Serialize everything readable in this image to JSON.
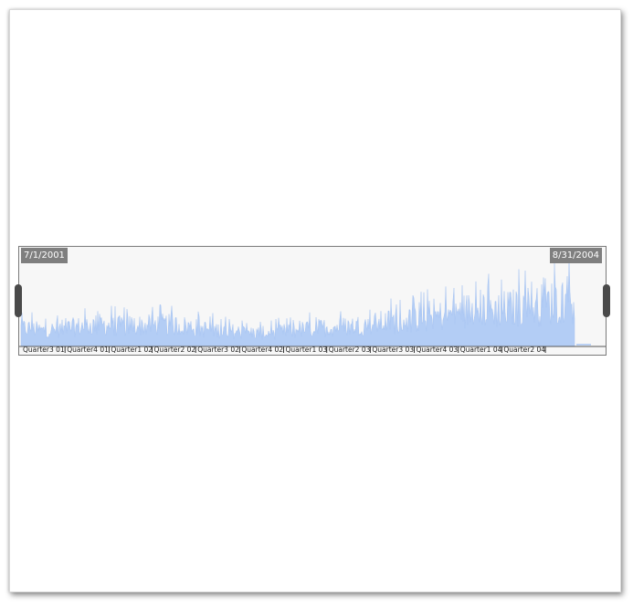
{
  "navigator": {
    "start_label": "7/1/2001",
    "end_label": "8/31/2004"
  },
  "colors": {
    "fill": "#b3cdf5",
    "stroke": "#a7c4f2",
    "background": "#f7f7f7",
    "label_bg": "#7f7f7f",
    "handle": "#4a4a4a"
  },
  "chart_data": {
    "type": "area",
    "xlabel": "",
    "ylabel": "",
    "tick_labels": [
      "Quarter3 01",
      "Quarter4 01",
      "Quarter1 02",
      "Quarter2 02",
      "Quarter3 02",
      "Quarter4 02",
      "Quarter1 03",
      "Quarter2 03",
      "Quarter3 03",
      "Quarter4 03",
      "Quarter1 04",
      "Quarter2 04"
    ],
    "x_range": [
      "2001-07-01",
      "2004-08-31"
    ],
    "ylim": [
      0,
      100
    ],
    "grid": false,
    "legend": "none",
    "series": [
      {
        "x": [
          "2001-07",
          "2001-08",
          "2001-09",
          "2001-10",
          "2001-11",
          "2001-12",
          "2002-01",
          "2002-02",
          "2002-03",
          "2002-04",
          "2002-05",
          "2002-06",
          "2002-07",
          "2002-08",
          "2002-09",
          "2002-10",
          "2002-11",
          "2002-12",
          "2003-01",
          "2003-02",
          "2003-03",
          "2003-04",
          "2003-05",
          "2003-06",
          "2003-07",
          "2003-08",
          "2003-09",
          "2003-10",
          "2003-11",
          "2003-12",
          "2004-01",
          "2004-02",
          "2004-03",
          "2004-04",
          "2004-05",
          "2004-06",
          "2004-07",
          "2004-08"
        ],
        "values": [
          30,
          26,
          28,
          31,
          34,
          36,
          33,
          35,
          34,
          36,
          35,
          33,
          29,
          27,
          25,
          23,
          22,
          23,
          26,
          28,
          30,
          32,
          33,
          35,
          38,
          41,
          43,
          46,
          49,
          52,
          58,
          63,
          60,
          62,
          65,
          67,
          72,
          75
        ]
      }
    ]
  }
}
